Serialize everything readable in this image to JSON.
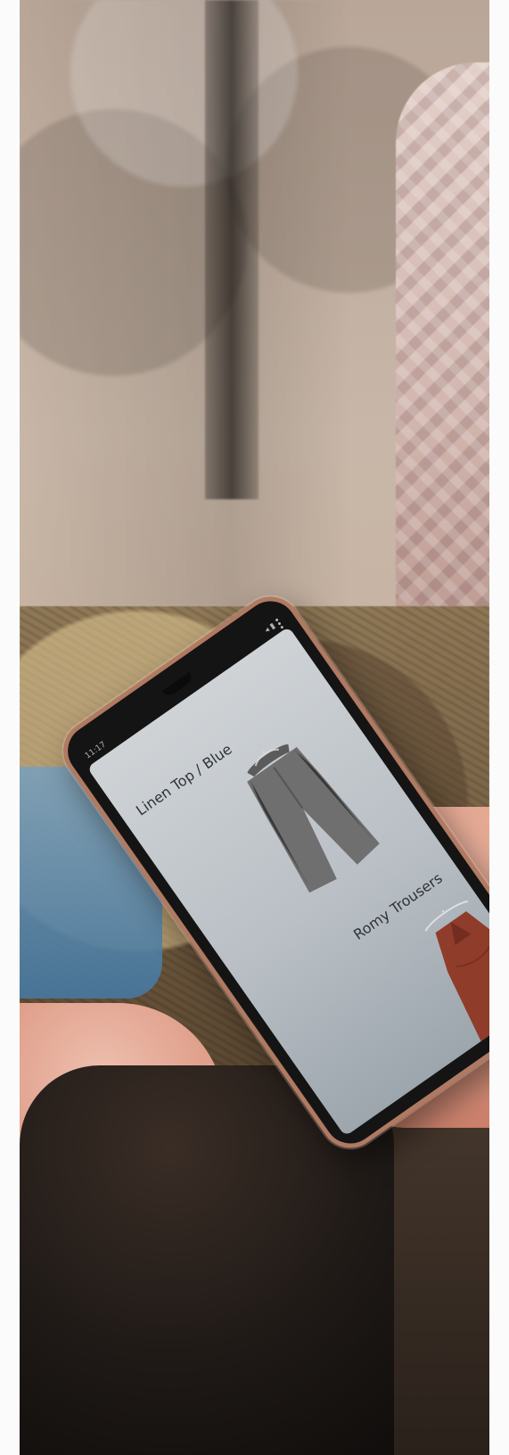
{
  "image": {
    "photo_subject": "hands holding phone browsing clothing",
    "phone_screen": {
      "status_time": "11:17",
      "status_icons": "◂ ▮",
      "menu_icon": "kebab-menu-icon",
      "url_text": "",
      "items": [
        {
          "label": "Linen Top / Blue",
          "image_icon": "trousers-icon",
          "image_color": "#6f6f6f"
        },
        {
          "label": "Romy Trousers",
          "image_icon": "dress-icon",
          "image_color": "#8f3c2a"
        }
      ]
    }
  }
}
